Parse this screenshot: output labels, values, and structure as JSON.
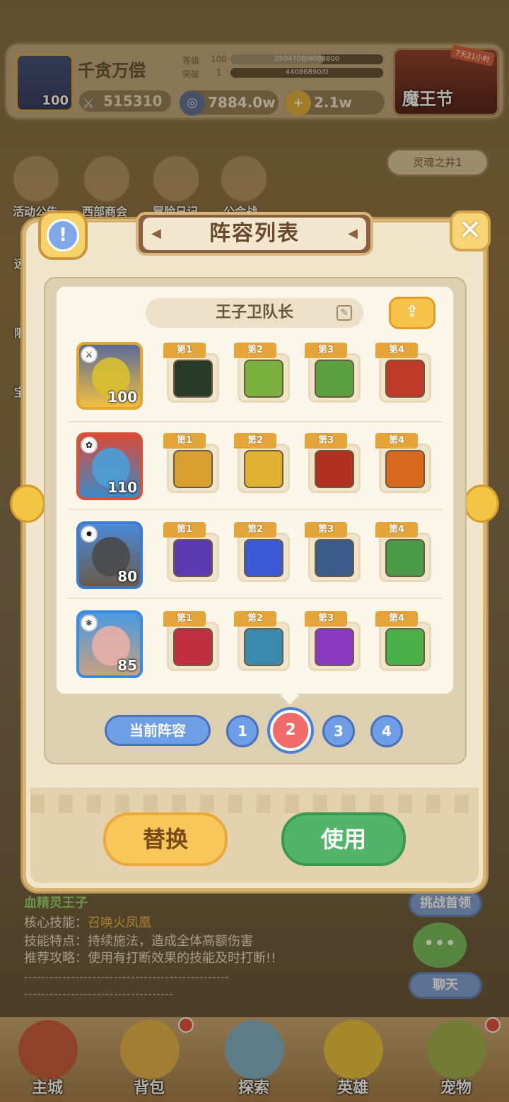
{
  "player": {
    "name": "千贪万偿",
    "level": "100",
    "power": "515310"
  },
  "stats": {
    "level_label": "等级",
    "level_value": "100",
    "exp_text": "2504708/4088800",
    "exp_fraction": 0.61,
    "break_label": "突破",
    "break_value": "1",
    "break_text": "44086890/0",
    "break_fraction": 0.0
  },
  "currency": {
    "gems": "7884.0w",
    "gold": "2.1w"
  },
  "event": {
    "name": "魔王节",
    "tag": "7天21小时"
  },
  "menu": {
    "items": [
      "活动公告",
      "西部商会",
      "冒险日记",
      "公会战"
    ]
  },
  "side": {
    "soulwell": "灵魂之井1",
    "left1": "远",
    "left2": "限",
    "left3": "宝"
  },
  "modal": {
    "title": "阵容列表",
    "team_name": "王子卫队长",
    "rows": [
      {
        "hero_level": "100",
        "skills": [
          "第1",
          "第2",
          "第3",
          "第4"
        ]
      },
      {
        "hero_level": "110",
        "skills": [
          "第1",
          "第2",
          "第3",
          "第4"
        ]
      },
      {
        "hero_level": "80",
        "skills": [
          "第1",
          "第2",
          "第3",
          "第4"
        ]
      },
      {
        "hero_level": "85",
        "skills": [
          "第1",
          "第2",
          "第3",
          "第4"
        ]
      }
    ],
    "current_label": "当前阵容",
    "tabs": [
      "1",
      "2",
      "3",
      "4"
    ],
    "selected_tab": "2",
    "replace_label": "替换",
    "use_label": "使用"
  },
  "boss_info": {
    "name": "血精灵王子",
    "core_label": "核心技能：",
    "core_value": "召唤火凤凰",
    "trait": "技能特点：持续施法，造成全体高额伤害",
    "tip": "推荐攻略：使用有打断效果的技能及时打断!!",
    "dash1": "------------------------------------------------",
    "dash2": "-----------------------------------"
  },
  "right_buttons": {
    "challenge": "挑战首领",
    "chat": "聊天"
  },
  "nav": {
    "items": [
      "主城",
      "背包",
      "探索",
      "英雄",
      "宠物"
    ]
  }
}
